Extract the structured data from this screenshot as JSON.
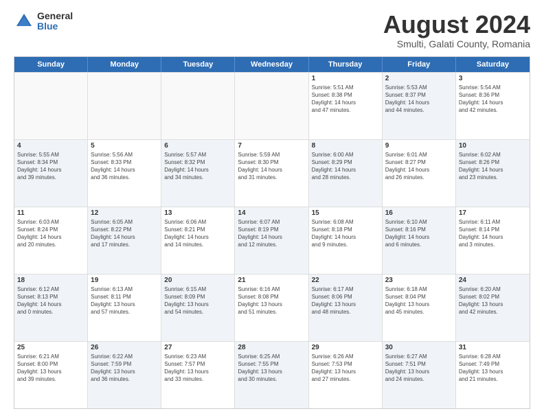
{
  "header": {
    "logo_general": "General",
    "logo_blue": "Blue",
    "main_title": "August 2024",
    "subtitle": "Smulti, Galati County, Romania"
  },
  "calendar": {
    "days_of_week": [
      "Sunday",
      "Monday",
      "Tuesday",
      "Wednesday",
      "Thursday",
      "Friday",
      "Saturday"
    ],
    "weeks": [
      [
        {
          "day": "",
          "info": "",
          "empty": true
        },
        {
          "day": "",
          "info": "",
          "empty": true
        },
        {
          "day": "",
          "info": "",
          "empty": true
        },
        {
          "day": "",
          "info": "",
          "empty": true
        },
        {
          "day": "1",
          "info": "Sunrise: 5:51 AM\nSunset: 8:38 PM\nDaylight: 14 hours\nand 47 minutes."
        },
        {
          "day": "2",
          "info": "Sunrise: 5:53 AM\nSunset: 8:37 PM\nDaylight: 14 hours\nand 44 minutes.",
          "shaded": true
        },
        {
          "day": "3",
          "info": "Sunrise: 5:54 AM\nSunset: 8:36 PM\nDaylight: 14 hours\nand 42 minutes."
        }
      ],
      [
        {
          "day": "4",
          "info": "Sunrise: 5:55 AM\nSunset: 8:34 PM\nDaylight: 14 hours\nand 39 minutes.",
          "shaded": true
        },
        {
          "day": "5",
          "info": "Sunrise: 5:56 AM\nSunset: 8:33 PM\nDaylight: 14 hours\nand 36 minutes."
        },
        {
          "day": "6",
          "info": "Sunrise: 5:57 AM\nSunset: 8:32 PM\nDaylight: 14 hours\nand 34 minutes.",
          "shaded": true
        },
        {
          "day": "7",
          "info": "Sunrise: 5:59 AM\nSunset: 8:30 PM\nDaylight: 14 hours\nand 31 minutes."
        },
        {
          "day": "8",
          "info": "Sunrise: 6:00 AM\nSunset: 8:29 PM\nDaylight: 14 hours\nand 28 minutes.",
          "shaded": true
        },
        {
          "day": "9",
          "info": "Sunrise: 6:01 AM\nSunset: 8:27 PM\nDaylight: 14 hours\nand 26 minutes."
        },
        {
          "day": "10",
          "info": "Sunrise: 6:02 AM\nSunset: 8:26 PM\nDaylight: 14 hours\nand 23 minutes.",
          "shaded": true
        }
      ],
      [
        {
          "day": "11",
          "info": "Sunrise: 6:03 AM\nSunset: 8:24 PM\nDaylight: 14 hours\nand 20 minutes."
        },
        {
          "day": "12",
          "info": "Sunrise: 6:05 AM\nSunset: 8:22 PM\nDaylight: 14 hours\nand 17 minutes.",
          "shaded": true
        },
        {
          "day": "13",
          "info": "Sunrise: 6:06 AM\nSunset: 8:21 PM\nDaylight: 14 hours\nand 14 minutes."
        },
        {
          "day": "14",
          "info": "Sunrise: 6:07 AM\nSunset: 8:19 PM\nDaylight: 14 hours\nand 12 minutes.",
          "shaded": true
        },
        {
          "day": "15",
          "info": "Sunrise: 6:08 AM\nSunset: 8:18 PM\nDaylight: 14 hours\nand 9 minutes."
        },
        {
          "day": "16",
          "info": "Sunrise: 6:10 AM\nSunset: 8:16 PM\nDaylight: 14 hours\nand 6 minutes.",
          "shaded": true
        },
        {
          "day": "17",
          "info": "Sunrise: 6:11 AM\nSunset: 8:14 PM\nDaylight: 14 hours\nand 3 minutes."
        }
      ],
      [
        {
          "day": "18",
          "info": "Sunrise: 6:12 AM\nSunset: 8:13 PM\nDaylight: 14 hours\nand 0 minutes.",
          "shaded": true
        },
        {
          "day": "19",
          "info": "Sunrise: 6:13 AM\nSunset: 8:11 PM\nDaylight: 13 hours\nand 57 minutes."
        },
        {
          "day": "20",
          "info": "Sunrise: 6:15 AM\nSunset: 8:09 PM\nDaylight: 13 hours\nand 54 minutes.",
          "shaded": true
        },
        {
          "day": "21",
          "info": "Sunrise: 6:16 AM\nSunset: 8:08 PM\nDaylight: 13 hours\nand 51 minutes."
        },
        {
          "day": "22",
          "info": "Sunrise: 6:17 AM\nSunset: 8:06 PM\nDaylight: 13 hours\nand 48 minutes.",
          "shaded": true
        },
        {
          "day": "23",
          "info": "Sunrise: 6:18 AM\nSunset: 8:04 PM\nDaylight: 13 hours\nand 45 minutes."
        },
        {
          "day": "24",
          "info": "Sunrise: 6:20 AM\nSunset: 8:02 PM\nDaylight: 13 hours\nand 42 minutes.",
          "shaded": true
        }
      ],
      [
        {
          "day": "25",
          "info": "Sunrise: 6:21 AM\nSunset: 8:00 PM\nDaylight: 13 hours\nand 39 minutes."
        },
        {
          "day": "26",
          "info": "Sunrise: 6:22 AM\nSunset: 7:59 PM\nDaylight: 13 hours\nand 36 minutes.",
          "shaded": true
        },
        {
          "day": "27",
          "info": "Sunrise: 6:23 AM\nSunset: 7:57 PM\nDaylight: 13 hours\nand 33 minutes."
        },
        {
          "day": "28",
          "info": "Sunrise: 6:25 AM\nSunset: 7:55 PM\nDaylight: 13 hours\nand 30 minutes.",
          "shaded": true
        },
        {
          "day": "29",
          "info": "Sunrise: 6:26 AM\nSunset: 7:53 PM\nDaylight: 13 hours\nand 27 minutes."
        },
        {
          "day": "30",
          "info": "Sunrise: 6:27 AM\nSunset: 7:51 PM\nDaylight: 13 hours\nand 24 minutes.",
          "shaded": true
        },
        {
          "day": "31",
          "info": "Sunrise: 6:28 AM\nSunset: 7:49 PM\nDaylight: 13 hours\nand 21 minutes."
        }
      ]
    ]
  }
}
